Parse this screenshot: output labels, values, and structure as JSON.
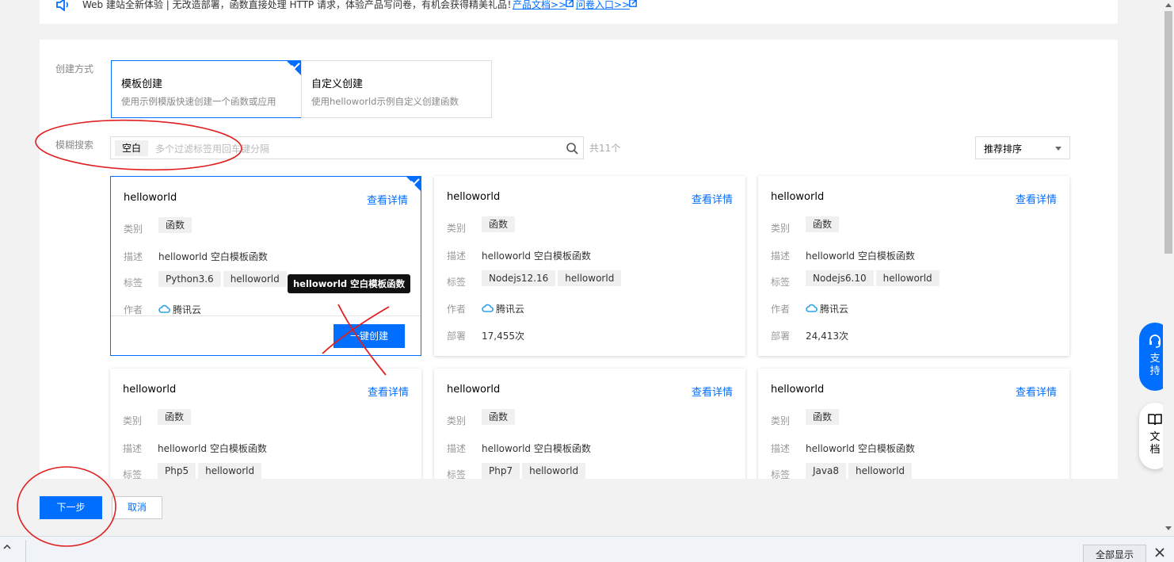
{
  "notice": {
    "message": "Web 建站全新体验 | 无改造部署，函数直接处理 HTTP 请求，体验产品写问卷，有机会获得精美礼品！",
    "docs_link": "产品文档>>",
    "survey_link": "问卷入口>>"
  },
  "create_method": {
    "label": "创建方式",
    "options": [
      {
        "title": "模板创建",
        "desc": "使用示例模版快速创建一个函数或应用",
        "selected": true
      },
      {
        "title": "自定义创建",
        "desc": "使用helloworld示例自定义创建函数",
        "selected": false
      }
    ]
  },
  "search": {
    "label": "模糊搜索",
    "tag": "空白",
    "placeholder": "多个过滤标签用回车键分隔",
    "count": "共11个"
  },
  "sort": {
    "value": "推荐排序"
  },
  "field_labels": {
    "category": "类别",
    "description": "描述",
    "tags": "标签",
    "author": "作者",
    "deploy": "部署"
  },
  "cards": [
    {
      "name": "helloworld",
      "detail": "查看详情",
      "category": "函数",
      "description": "helloworld 空白模板函数",
      "tags": [
        "Python3.6",
        "helloworld"
      ],
      "author": "腾讯云",
      "create": "一键创建",
      "selected": true
    },
    {
      "name": "helloworld",
      "detail": "查看详情",
      "category": "函数",
      "description": "helloworld 空白模板函数",
      "tags": [
        "Nodejs12.16",
        "helloworld"
      ],
      "author": "腾讯云",
      "deploy": "17,455次"
    },
    {
      "name": "helloworld",
      "detail": "查看详情",
      "category": "函数",
      "description": "helloworld 空白模板函数",
      "tags": [
        "Nodejs6.10",
        "helloworld"
      ],
      "author": "腾讯云",
      "deploy": "24,413次"
    },
    {
      "name": "helloworld",
      "detail": "查看详情",
      "category": "函数",
      "description": "helloworld 空白模板函数",
      "tags": [
        "Php5",
        "helloworld"
      ]
    },
    {
      "name": "helloworld",
      "detail": "查看详情",
      "category": "函数",
      "description": "helloworld 空白模板函数",
      "tags": [
        "Php7",
        "helloworld"
      ]
    },
    {
      "name": "helloworld",
      "detail": "查看详情",
      "category": "函数",
      "description": "helloworld 空白模板函数",
      "tags": [
        "Java8",
        "helloworld"
      ]
    }
  ],
  "tooltip": "helloworld 空白模板函数",
  "actions": {
    "next": "下一步",
    "cancel": "取消"
  },
  "side": {
    "support": "支持",
    "docs": "文档"
  },
  "bottom": {
    "show_all": "全部显示"
  },
  "colors": {
    "primary": "#006eff",
    "annotation": "#e02020"
  }
}
